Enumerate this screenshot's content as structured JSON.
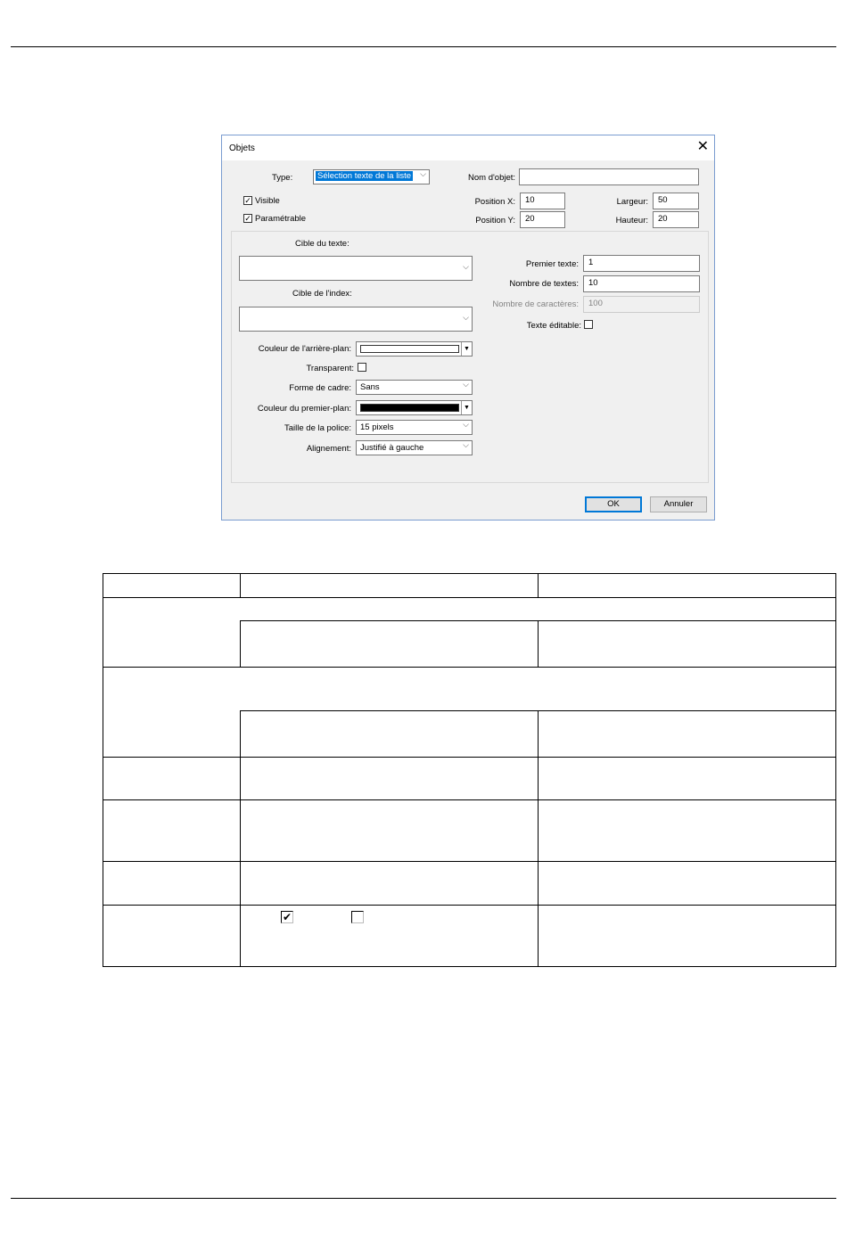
{
  "dialog": {
    "title": "Objets",
    "close_glyph": "✕",
    "type_label": "Type:",
    "type_value": "Sélection texte de la liste",
    "nom_label": "Nom d'objet:",
    "nom_value": "",
    "visible_label": "Visible",
    "visible_checked": true,
    "parametrable_label": "Paramétrable",
    "parametrable_checked": true,
    "posx_label": "Position X:",
    "posx_value": "10",
    "posy_label": "Position Y:",
    "posy_value": "20",
    "largeur_label": "Largeur:",
    "largeur_value": "50",
    "hauteur_label": "Hauteur:",
    "hauteur_value": "20",
    "cible_texte_label": "Cible du texte:",
    "cible_texte_value": "",
    "cible_index_label": "Cible de l'index:",
    "cible_index_value": "",
    "couleur_arriere_label": "Couleur de l'arrière-plan:",
    "couleur_arriere_color": "#ffffff",
    "transparent_label": "Transparent:",
    "transparent_checked": false,
    "forme_cadre_label": "Forme de cadre:",
    "forme_cadre_value": "Sans",
    "couleur_premier_label": "Couleur du premier-plan:",
    "couleur_premier_color": "#000000",
    "taille_police_label": "Taille de la police:",
    "taille_police_value": "15 pixels",
    "alignement_label": "Alignement:",
    "alignement_value": "Justifié à gauche",
    "premier_texte_label": "Premier texte:",
    "premier_texte_value": "1",
    "nombre_textes_label": "Nombre de textes:",
    "nombre_textes_value": "10",
    "nombre_caracteres_label": "Nombre de caractères:",
    "nombre_caracteres_value": "100",
    "texte_editable_label": "Texte éditable:",
    "texte_editable_checked": false,
    "ok_label": "OK",
    "annuler_label": "Annuler",
    "accent_color": "#0078d7"
  },
  "table": {
    "checkbox_checked_glyph": "✔"
  }
}
